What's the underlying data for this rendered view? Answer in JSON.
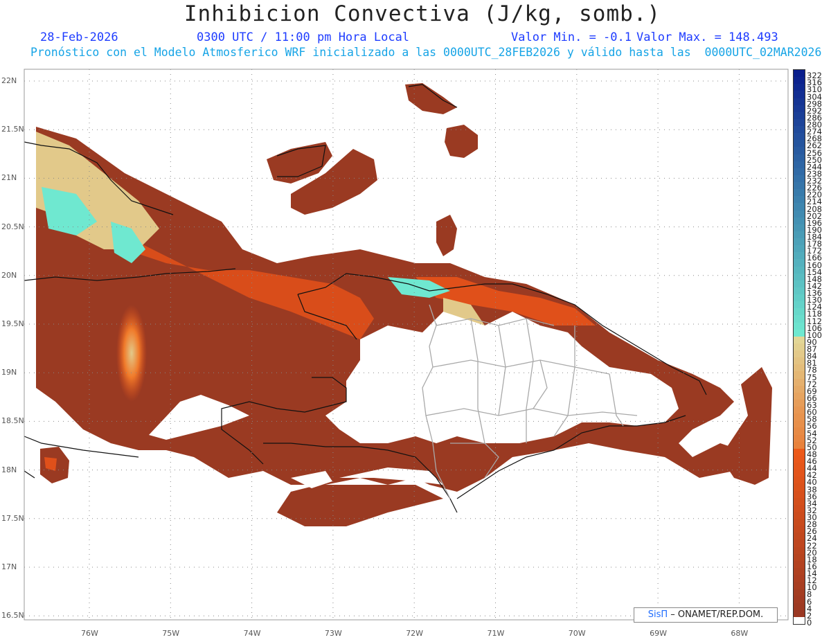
{
  "title": "Inhibicion Convectiva (J/kg, somb.)",
  "date_text": "28-Feb-2026",
  "time_text": "0300 UTC / 11:00 pm Hora Local",
  "min_text": "Valor Min. = -0.1",
  "max_text": "Valor Max. = 148.493",
  "subtitle": "Pronóstico con el Modelo Atmosferico WRF inicializado a las 0000UTC_28FEB2026 y válido hasta las  0000UTC_02MAR2026",
  "credit": {
    "brand": "SisΠ",
    "text": " – ONAMET/REP.DOM."
  },
  "lat_labels": [
    "22N",
    "21.5N",
    "21N",
    "20.5N",
    "20N",
    "19.5N",
    "19N",
    "18.5N",
    "18N",
    "17.5N",
    "17N",
    "16.5N"
  ],
  "lon_labels": [
    "76W",
    "75W",
    "74W",
    "73W",
    "72W",
    "71W",
    "70W",
    "69W",
    "68W"
  ],
  "colorbar_labels": [
    "322",
    "316",
    "310",
    "304",
    "298",
    "292",
    "286",
    "280",
    "274",
    "268",
    "262",
    "256",
    "250",
    "244",
    "238",
    "232",
    "226",
    "220",
    "214",
    "208",
    "202",
    "196",
    "190",
    "184",
    "178",
    "172",
    "166",
    "160",
    "154",
    "148",
    "142",
    "136",
    "130",
    "124",
    "118",
    "112",
    "106",
    "100",
    "90",
    "87",
    "84",
    "81",
    "78",
    "75",
    "72",
    "69",
    "66",
    "63",
    "60",
    "58",
    "56",
    "54",
    "52",
    "50",
    "48",
    "46",
    "44",
    "42",
    "40",
    "38",
    "36",
    "34",
    "32",
    "30",
    "28",
    "26",
    "24",
    "22",
    "20",
    "18",
    "16",
    "14",
    "12",
    "10",
    "8",
    "6",
    "4",
    "2",
    "0"
  ],
  "colors": {
    "low": "#9a3a22",
    "mid": "#e0501a",
    "orange": "#f07a2a",
    "cream": "#e2c98a",
    "cyan": "#6fe8d0",
    "high_blue": "#0a1e8c",
    "coast": "#111111",
    "border": "#a9a9a9"
  }
}
